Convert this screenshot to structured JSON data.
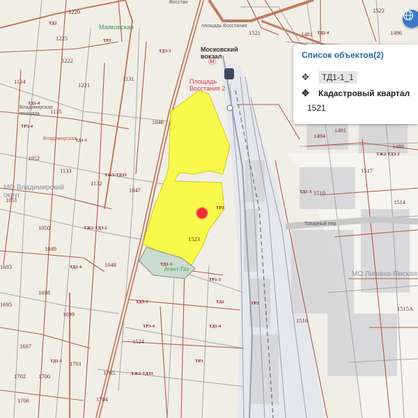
{
  "map": {
    "streets": {
      "vosstaniya_top": "Восстан",
      "ploshchad_vosstaniya": "площадь Восстания",
      "tovarny_per": "Товарный пер",
      "vladimirskaya": "Владимирская",
      "vladimirskaya_sq": "Владимирская площадь"
    },
    "poi": {
      "mayakovskaya": "Маяковская",
      "moskovsky_vokzal": "Московский вокзал",
      "ploshchad_vosstaniya_2": "Площадь Восстания 2",
      "green_area": "Агент-Газ"
    },
    "districts": {
      "vladimirsky": "МО Владимирский округ",
      "ligovka": "МО Лиговка-Ямская"
    },
    "blocks": [
      "1220",
      "1225",
      "1222",
      "1221",
      "1124",
      "1131",
      "1135",
      "1052",
      "1133",
      "1051",
      "1050",
      "1049",
      "1048",
      "1047",
      "1046",
      "1132",
      "1693",
      "1695",
      "1698",
      "1699",
      "1697",
      "1700",
      "1701",
      "1702",
      "1706",
      "1705",
      "1704",
      "1524",
      "1523",
      "1522",
      "1521",
      "1481",
      "1496",
      "1493",
      "1488",
      "1491",
      "1494",
      "1517",
      "1510",
      "1514",
      "1515A",
      "1516",
      "1518",
      "1519",
      "1515Б"
    ],
    "zones": [
      "ТД2",
      "ТР2",
      "ТДЗ-3",
      "ТД1-4",
      "ТР3-4",
      "ТД1-1",
      "ТЖ3-ТДЗЗ",
      "ТР3",
      "ТЖ2-ТДЗ-2",
      "ТД2-4",
      "ТД1-3",
      "ТР1-3"
    ]
  },
  "panel": {
    "title": "Список объектов(2)",
    "items": [
      {
        "label": "ТД1-1_1"
      },
      {
        "label": "Кадастровый квартал"
      }
    ],
    "value": "1521"
  },
  "colors": {
    "selection_fill": "#fafa3c",
    "marker": "#e8342a",
    "road_main": "#c07b64",
    "rail_area": "#e5e7ee",
    "panel_title": "#1d6aa5",
    "button": "#3a79c9"
  },
  "icons": {
    "move": "move-arrows-icon",
    "globe": "globe-icon",
    "metro": "metro-icon",
    "rail": "railway-station-icon"
  }
}
